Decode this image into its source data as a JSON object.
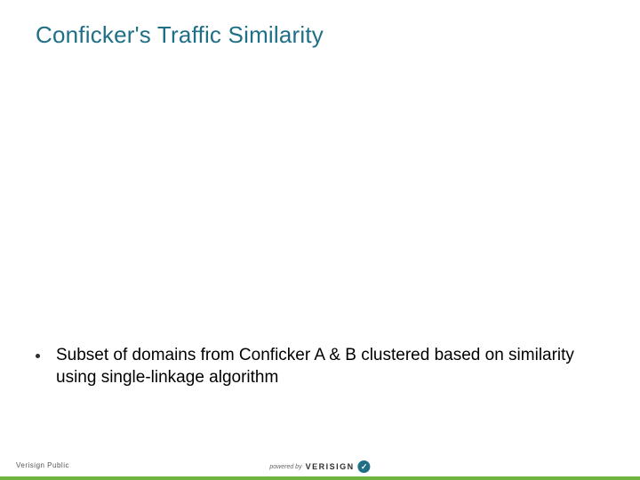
{
  "title": "Conficker's Traffic Similarity",
  "bullets": [
    "Subset of domains from Conficker A & B clustered based on similarity using single-linkage algorithm"
  ],
  "footer": {
    "classification": "Verisign Public",
    "powered_prefix": "powered by",
    "brand": "VERISIGN"
  }
}
